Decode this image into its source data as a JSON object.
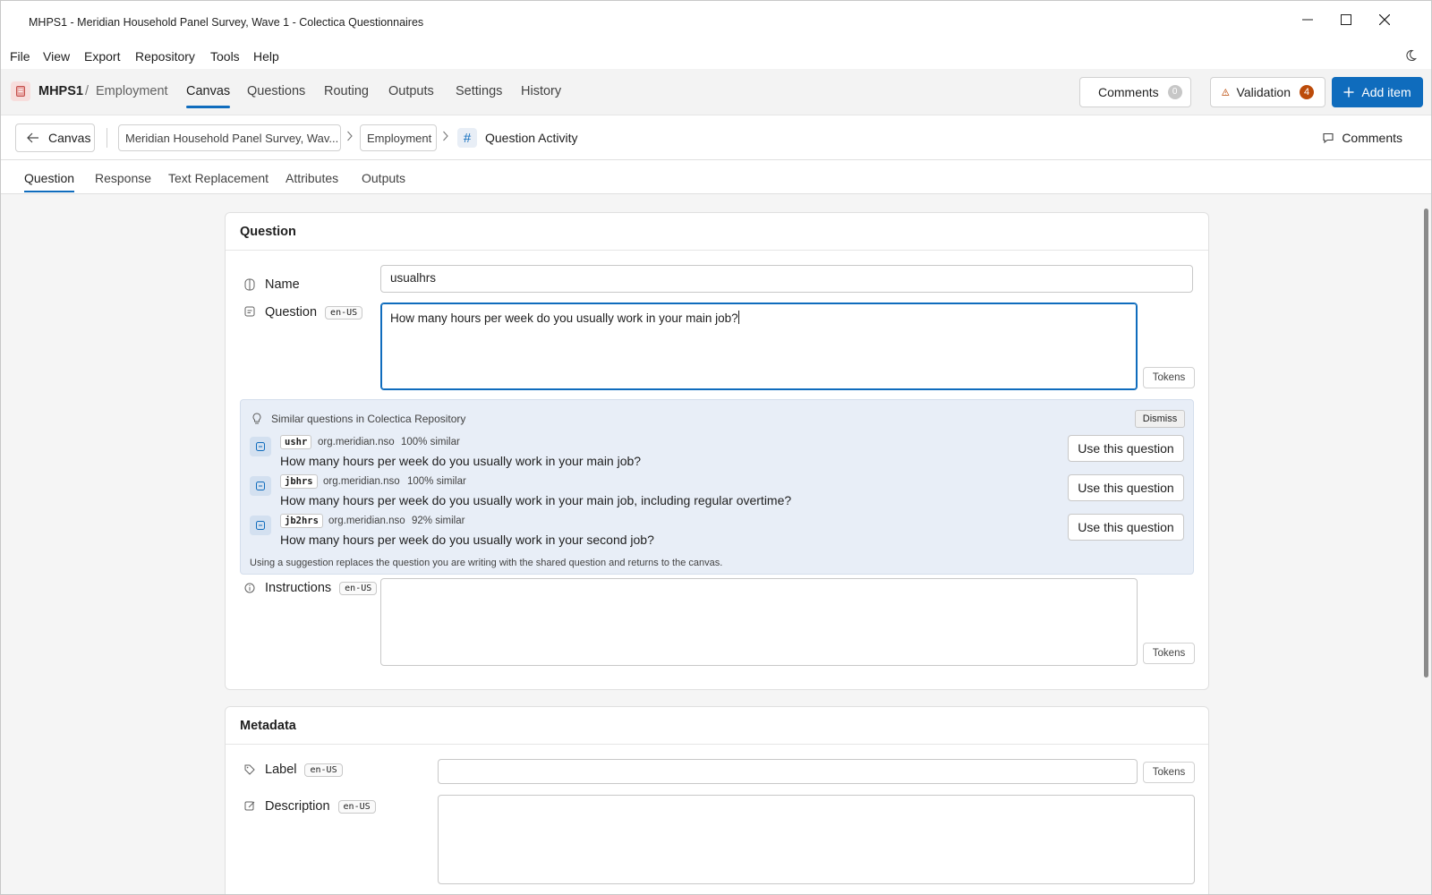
{
  "window": {
    "title": "MHPS1 - Meridian Household Panel Survey, Wave 1 - Colectica Questionnaires"
  },
  "menu": [
    "File",
    "View",
    "Export",
    "Repository",
    "Tools",
    "Help"
  ],
  "app": {
    "doc_code": "MHPS1",
    "separator": "/",
    "section": "Employment",
    "nav_tabs": [
      "Canvas",
      "Questions",
      "Routing",
      "Outputs",
      "Settings",
      "History"
    ],
    "active_tab": "Canvas",
    "comments_label": "Comments",
    "comments_count": "0",
    "validation_label": "Validation",
    "validation_count": "4",
    "add_item_label": "Add item"
  },
  "breadcrumb": {
    "back_label": "Canvas",
    "survey": "Meridian Household Panel Survey, Wav...",
    "section": "Employment",
    "current": "Question Activity",
    "comments_label": "Comments"
  },
  "sub_tabs": [
    "Question",
    "Response",
    "Text Replacement",
    "Attributes",
    "Outputs"
  ],
  "question_card": {
    "heading": "Question",
    "name_label": "Name",
    "name_value": "usualhrs",
    "question_label": "Question",
    "lang": "en-US",
    "question_value": "How many hours per week do you usually work in your main job?",
    "tokens_label": "Tokens",
    "instructions_label": "Instructions",
    "instructions_value": ""
  },
  "similar": {
    "title": "Similar questions in Colectica Repository",
    "dismiss_label": "Dismiss",
    "use_label": "Use this question",
    "items": [
      {
        "code": "ushr",
        "agency": "org.meridian.nso",
        "similarity": "100% similar",
        "text": "How many hours per week do you usually work in your main job?"
      },
      {
        "code": "jbhrs",
        "agency": "org.meridian.nso",
        "similarity": "100% similar",
        "text": "How many hours per week do you usually work in your main job, including regular overtime?"
      },
      {
        "code": "jb2hrs",
        "agency": "org.meridian.nso",
        "similarity": "92% similar",
        "text": "How many hours per week do you usually work in your second job?"
      }
    ],
    "note": "Using a suggestion replaces the question you are writing with the shared question and returns to the canvas."
  },
  "metadata_card": {
    "heading": "Metadata",
    "label_label": "Label",
    "label_value": "",
    "description_label": "Description",
    "lang": "en-US",
    "tokens_label": "Tokens"
  },
  "icons": {
    "doc": "document-icon",
    "back": "arrow-left-icon",
    "chevron": "chevron-right-icon",
    "hash": "hash-icon",
    "comment": "comment-icon",
    "warning": "warning-icon",
    "add": "plus-icon",
    "moon": "moon-icon",
    "lightbulb": "lightbulb-icon"
  },
  "colors": {
    "accent": "#0f6cbd",
    "warning_badge": "#bc4b09",
    "suggestion_bg": "#e8eef7"
  }
}
